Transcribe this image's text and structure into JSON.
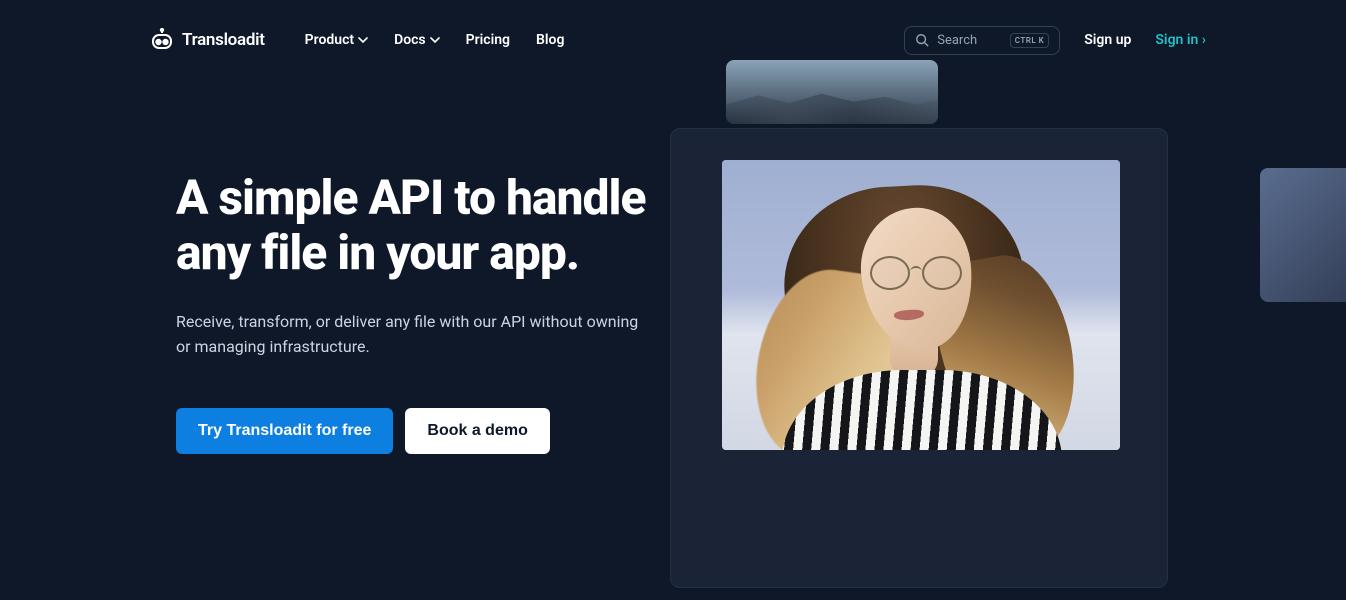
{
  "header": {
    "brand": "Transloadit",
    "nav": [
      {
        "label": "Product",
        "dropdown": true
      },
      {
        "label": "Docs",
        "dropdown": true
      },
      {
        "label": "Pricing",
        "dropdown": false
      },
      {
        "label": "Blog",
        "dropdown": false
      }
    ],
    "search": {
      "placeholder": "Search",
      "shortcut": "CTRL K"
    },
    "signup": "Sign up",
    "signin": "Sign in ›"
  },
  "hero": {
    "title": "A simple API to handle any file in your app.",
    "subtitle": "Receive, transform, or deliver any file with our API without owning or managing infrastructure.",
    "cta_primary": "Try Transloadit for free",
    "cta_secondary": "Book a demo"
  }
}
